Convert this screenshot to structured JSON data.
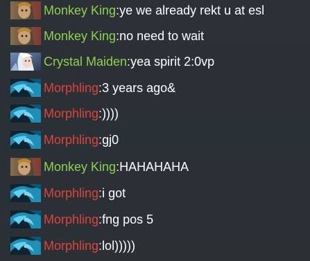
{
  "colors": {
    "background": "#2b3035",
    "name_green": "#8fd14f",
    "name_red": "#e0433a",
    "message": "#ffffff"
  },
  "messages": [
    {
      "hero": "Monkey King",
      "avatar_icon": "monkey-king-portrait-icon",
      "color": "green",
      "sep": ":",
      "text": " ye we already rekt u at esl"
    },
    {
      "hero": "Monkey King",
      "avatar_icon": "monkey-king-portrait-icon",
      "color": "green",
      "sep": ":",
      "text": " no need to wait"
    },
    {
      "hero": "Crystal Maiden",
      "avatar_icon": "crystal-maiden-portrait-icon",
      "color": "green",
      "sep": ":",
      "text": " yea spirit 2:0vp"
    },
    {
      "hero": "Morphling",
      "avatar_icon": "morphling-portrait-icon",
      "color": "red",
      "sep": ":",
      "text": " 3 years ago&"
    },
    {
      "hero": "Morphling",
      "avatar_icon": "morphling-portrait-icon",
      "color": "red",
      "sep": ":",
      "text": " ))))"
    },
    {
      "hero": "Morphling",
      "avatar_icon": "morphling-portrait-icon",
      "color": "red",
      "sep": ":",
      "text": " gj0"
    },
    {
      "hero": "Monkey King",
      "avatar_icon": "monkey-king-portrait-icon",
      "color": "green",
      "sep": ":",
      "text": " HAHAHAHA"
    },
    {
      "hero": "Morphling",
      "avatar_icon": "morphling-portrait-icon",
      "color": "red",
      "sep": ":",
      "text": " i got"
    },
    {
      "hero": "Morphling",
      "avatar_icon": "morphling-portrait-icon",
      "color": "red",
      "sep": ":",
      "text": " fng pos 5"
    },
    {
      "hero": "Morphling",
      "avatar_icon": "morphling-portrait-icon",
      "color": "red",
      "sep": ":",
      "text": " lol)))))"
    }
  ]
}
